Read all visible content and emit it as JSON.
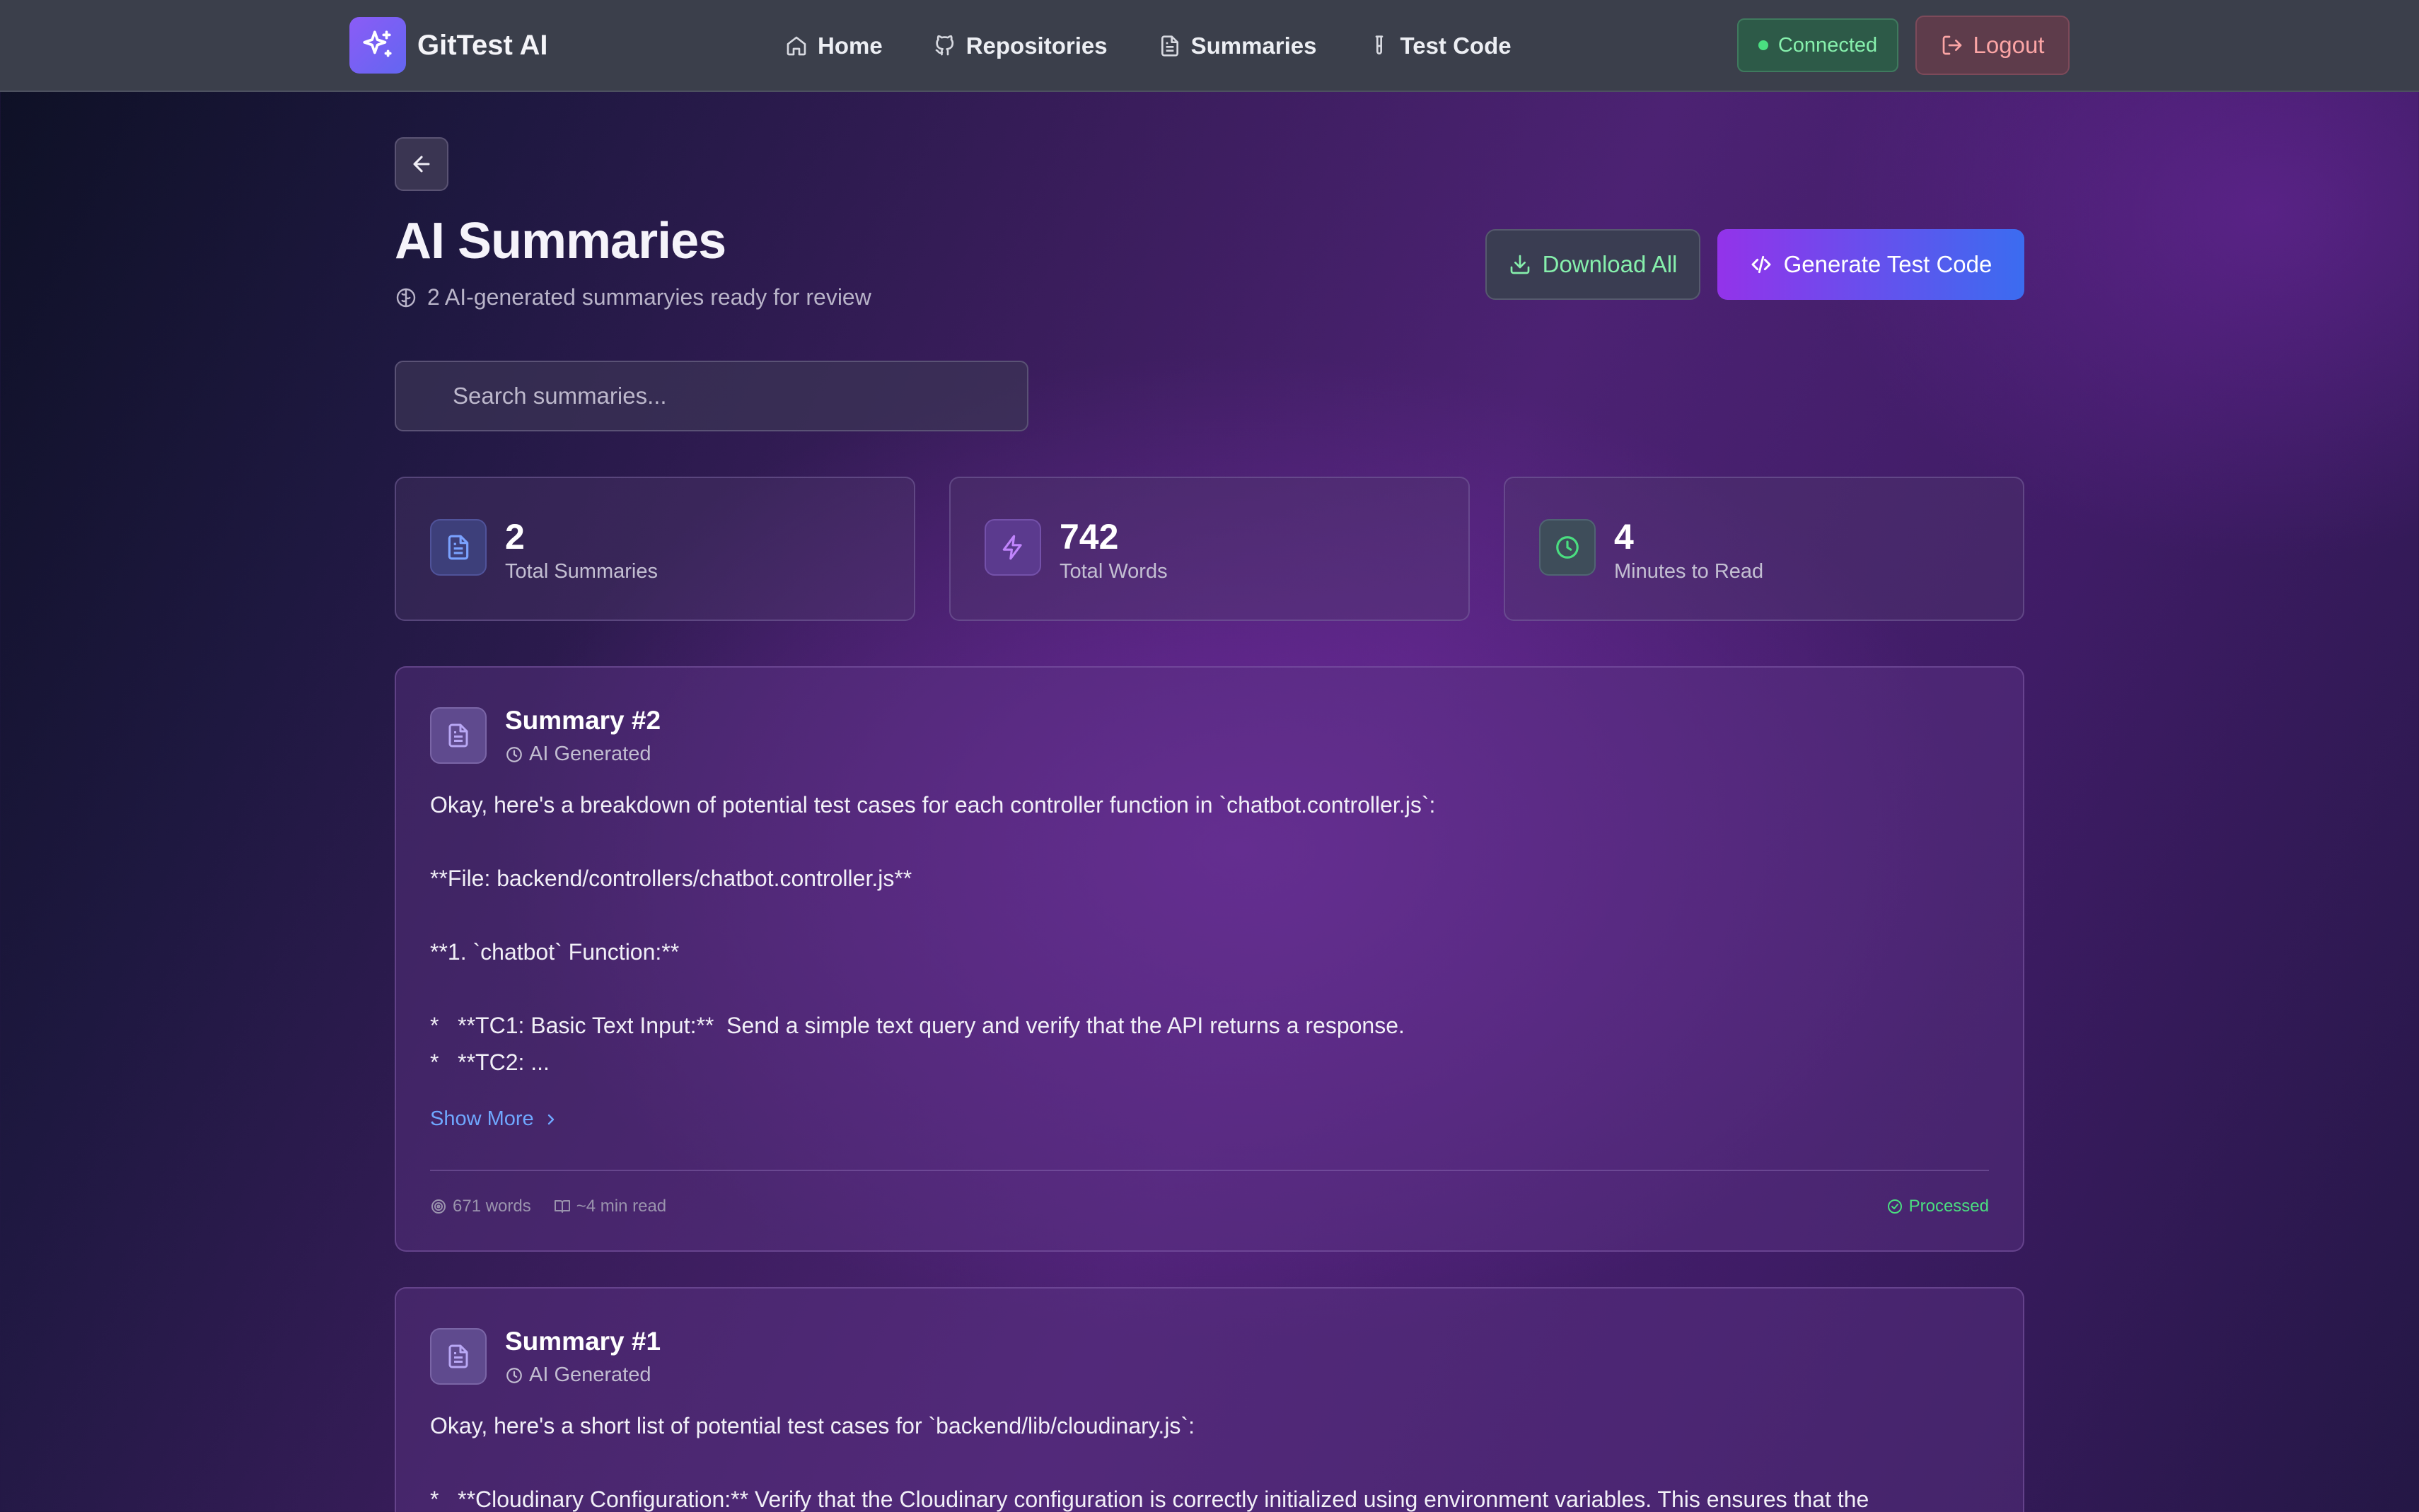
{
  "nav": {
    "brand": "GitTest AI",
    "links": [
      "Home",
      "Repositories",
      "Summaries",
      "Test Code"
    ],
    "status": "Connected",
    "logout": "Logout"
  },
  "header": {
    "title": "AI Summaries",
    "subtitle": "2 AI-generated summaryies ready for review",
    "download_all": "Download All",
    "generate": "Generate Test Code"
  },
  "search": {
    "placeholder": "Search summaries..."
  },
  "stats": [
    {
      "value": "2",
      "label": "Total Summaries"
    },
    {
      "value": "742",
      "label": "Total Words"
    },
    {
      "value": "4",
      "label": "Minutes to Read"
    }
  ],
  "summaries": [
    {
      "title": "Summary #2",
      "meta": "AI Generated",
      "body": "Okay, here's a breakdown of potential test cases for each controller function in `chatbot.controller.js`:\n\n**File: backend/controllers/chatbot.controller.js**\n\n**1. `chatbot` Function:**\n\n*   **TC1: Basic Text Input:**  Send a simple text query and verify that the API returns a response.\n*   **TC2: ...",
      "show_more": "Show More",
      "words": "671 words",
      "read": "~4 min read",
      "status": "Processed"
    },
    {
      "title": "Summary #1",
      "meta": "AI Generated",
      "body": "Okay, here's a short list of potential test cases for `backend/lib/cloudinary.js`:\n\n*   **Cloudinary Configuration:** Verify that the Cloudinary configuration is correctly initialized using environment variables. This ensures that the"
    }
  ],
  "colors": {
    "accent_purple": "#9333ea",
    "accent_blue": "#3b6cf0",
    "success": "#4ade80",
    "danger": "#fca5a5",
    "link": "#6fa8ff"
  },
  "icons": {
    "brand": "sparkles-icon",
    "home": "home-icon",
    "repositories": "github-icon",
    "summaries": "file-text-icon",
    "test_code": "test-tube-icon",
    "logout": "logout-icon",
    "back": "arrow-left-icon",
    "subtitle": "brain-icon",
    "download": "download-icon",
    "generate": "code-icon",
    "stat_summaries": "file-text-icon",
    "stat_words": "zap-icon",
    "stat_minutes": "clock-icon"
  }
}
